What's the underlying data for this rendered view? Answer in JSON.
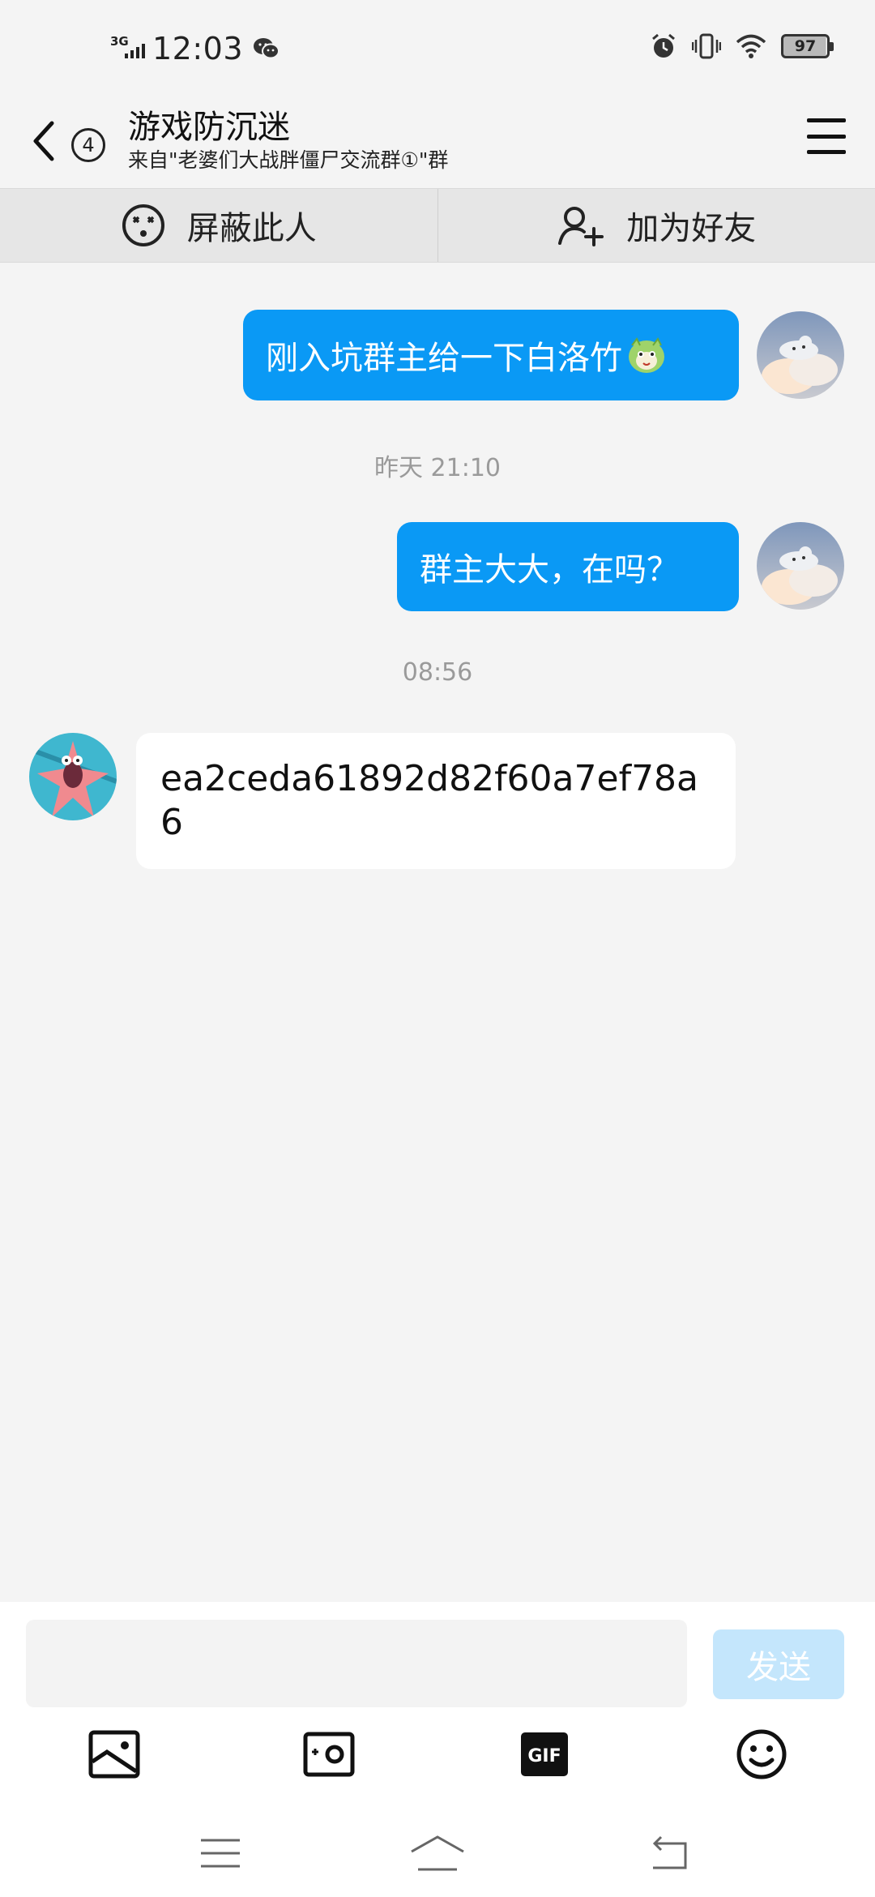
{
  "status_bar": {
    "network": "3G",
    "time": "12:03",
    "battery": "97"
  },
  "header": {
    "unread_count": "4",
    "title": "游戏防沉迷",
    "subtitle": "来自\"老婆们大战胖僵尸交流群①\"群"
  },
  "actions": {
    "block_label": "屏蔽此人",
    "add_friend_label": "加为好友"
  },
  "messages": [
    {
      "direction": "out",
      "text": "刚入坑群主给一下白洛竹",
      "has_emoji": true
    },
    {
      "type": "time",
      "text": "昨天 21:10"
    },
    {
      "direction": "out",
      "text": "群主大大，在吗？"
    },
    {
      "type": "time",
      "text": "08:56"
    },
    {
      "direction": "in",
      "text": "ea2ceda61892d82f60a7ef78a6"
    }
  ],
  "input": {
    "value": "",
    "send_label": "发送"
  },
  "toolbar": {
    "icons": [
      "image-icon",
      "camera-icon",
      "gif-icon",
      "emoji-icon"
    ],
    "gif_label": "GIF"
  },
  "colors": {
    "accent": "#0a99f5",
    "send_disabled": "#c4e6fc",
    "background": "#f4f4f4",
    "action_bar": "#e6e6e6"
  }
}
